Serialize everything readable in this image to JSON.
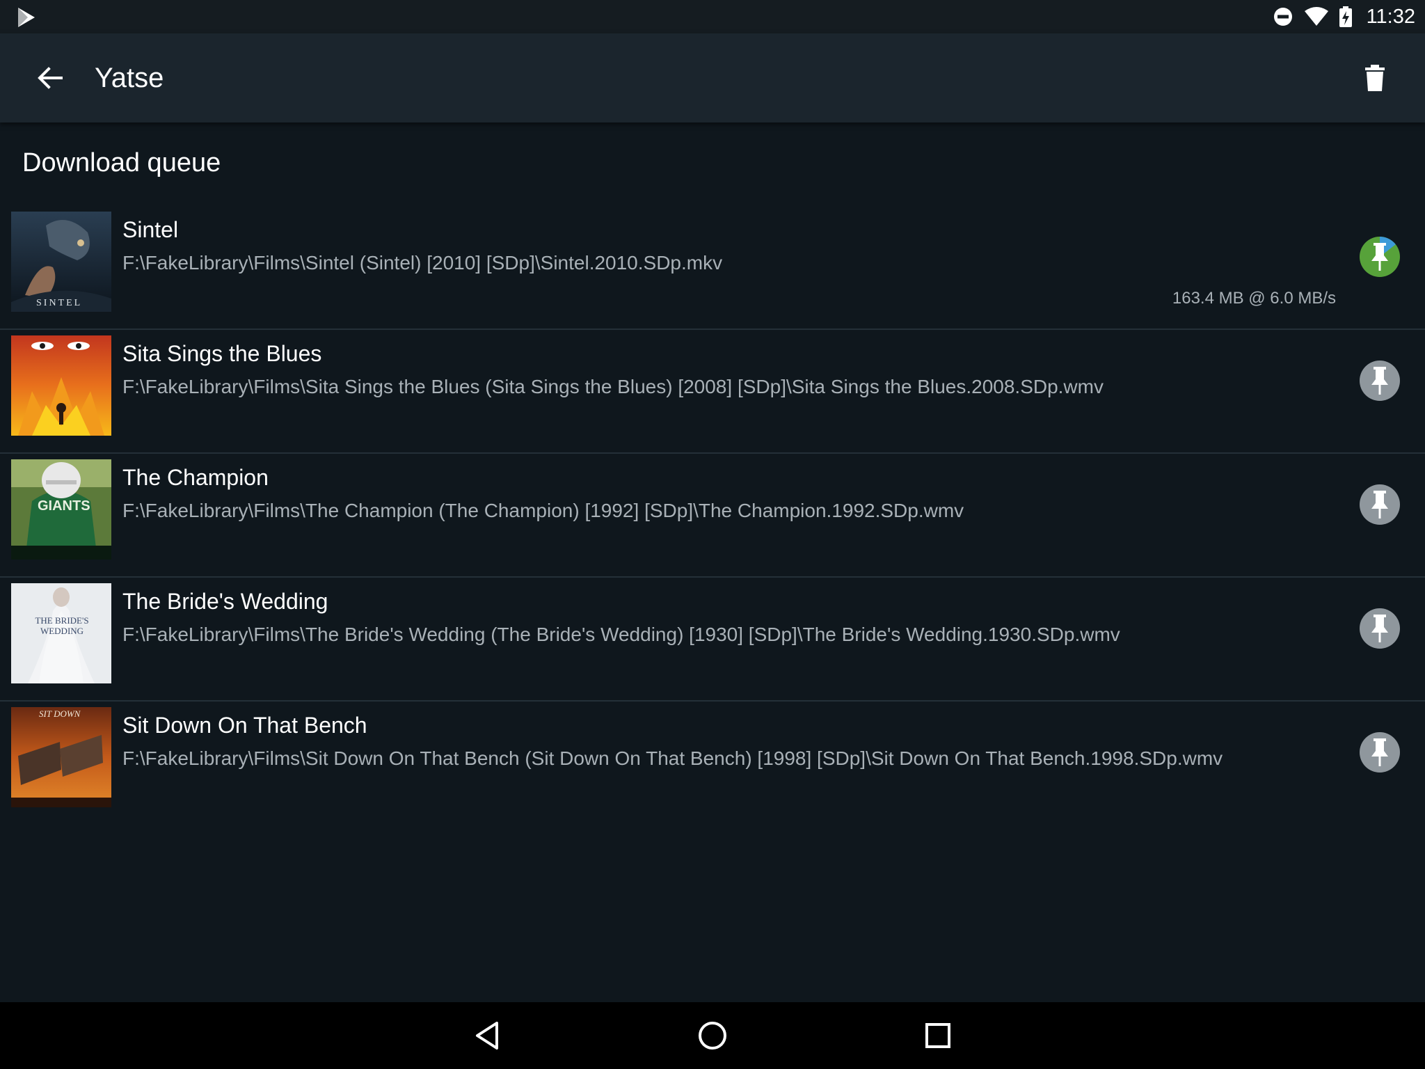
{
  "status_bar": {
    "time": "11:32",
    "icons": [
      "play-store-icon",
      "do-not-disturb-icon",
      "wifi-icon",
      "battery-charging-icon"
    ]
  },
  "app_bar": {
    "title": "Yatse",
    "back_icon": "arrow-left-icon",
    "action_icon": "trash-icon"
  },
  "section": {
    "title": "Download queue"
  },
  "queue": [
    {
      "title": "Sintel",
      "path": "F:\\FakeLibrary\\Films\\Sintel (Sintel) [2010] [SDp]\\Sintel.2010.SDp.mkv",
      "progress": "163.4 MB @ 6.0 MB/s",
      "active": true,
      "poster_text": "SINTEL"
    },
    {
      "title": "Sita Sings the Blues",
      "path": "F:\\FakeLibrary\\Films\\Sita Sings the Blues (Sita Sings the Blues) [2008] [SDp]\\Sita Sings the Blues.2008.SDp.wmv",
      "progress": "",
      "active": false,
      "poster_text": ""
    },
    {
      "title": "The Champion",
      "path": "F:\\FakeLibrary\\Films\\The Champion (The Champion) [1992] [SDp]\\The Champion.1992.SDp.wmv",
      "progress": "",
      "active": false,
      "poster_text": "GIANTS"
    },
    {
      "title": "The Bride's Wedding",
      "path": "F:\\FakeLibrary\\Films\\The Bride's Wedding (The Bride's Wedding) [1930] [SDp]\\The Bride's Wedding.1930.SDp.wmv",
      "progress": "",
      "active": false,
      "poster_text": "THE BRIDE'S WEDDING"
    },
    {
      "title": "Sit Down On That Bench",
      "path": "F:\\FakeLibrary\\Films\\Sit Down On That Bench (Sit Down On That Bench) [1998] [SDp]\\Sit Down On That Bench.1998.SDp.wmv",
      "progress": "",
      "active": false,
      "poster_text": "SIT DOWN"
    }
  ],
  "colors": {
    "background": "#0f171d",
    "app_bar": "#1b252d",
    "pin_active": "#57a23a",
    "pin_inactive": "#8f979d",
    "secondary_text": "#a9b1b7"
  },
  "nav_bar": {
    "icons": [
      "nav-back-icon",
      "nav-home-icon",
      "nav-recents-icon"
    ]
  }
}
